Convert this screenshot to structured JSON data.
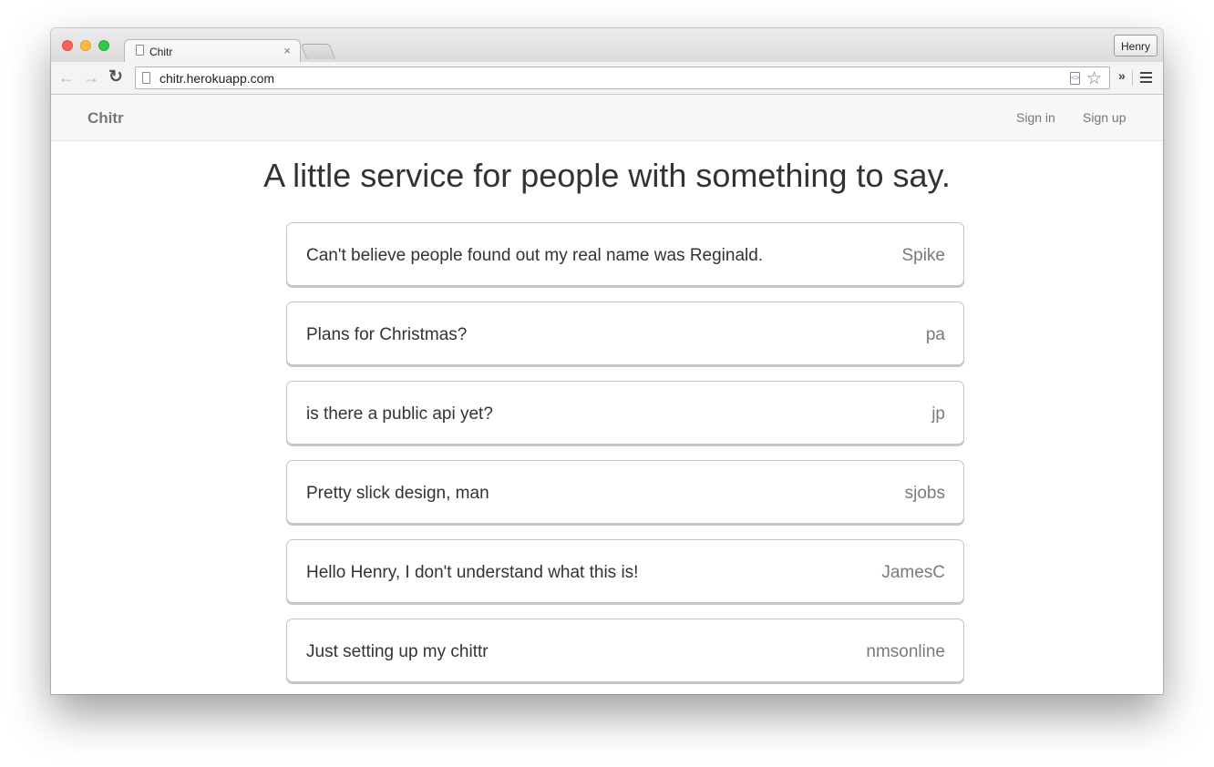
{
  "browser": {
    "tab_title": "Chitr",
    "tab_close": "×",
    "profile_name": "Henry",
    "url": "chitr.herokuapp.com",
    "icons": [
      "back-arrow-icon",
      "forward-arrow-icon",
      "reload-icon",
      "page-icon",
      "star-icon",
      "menu-icon"
    ]
  },
  "navbar": {
    "brand": "Chitr",
    "sign_in": "Sign in",
    "sign_up": "Sign up"
  },
  "headline": "A little service for people with something to say.",
  "posts": [
    {
      "message": "Can't believe people found out my real name was Reginald.",
      "user": "Spike"
    },
    {
      "message": "Plans for Christmas?",
      "user": "pa"
    },
    {
      "message": "is there a public api yet?",
      "user": "jp"
    },
    {
      "message": "Pretty slick design, man",
      "user": "sjobs"
    },
    {
      "message": "Hello Henry, I don't understand what this is!",
      "user": "JamesC"
    },
    {
      "message": "Just setting up my chittr",
      "user": "nmsonline"
    }
  ]
}
